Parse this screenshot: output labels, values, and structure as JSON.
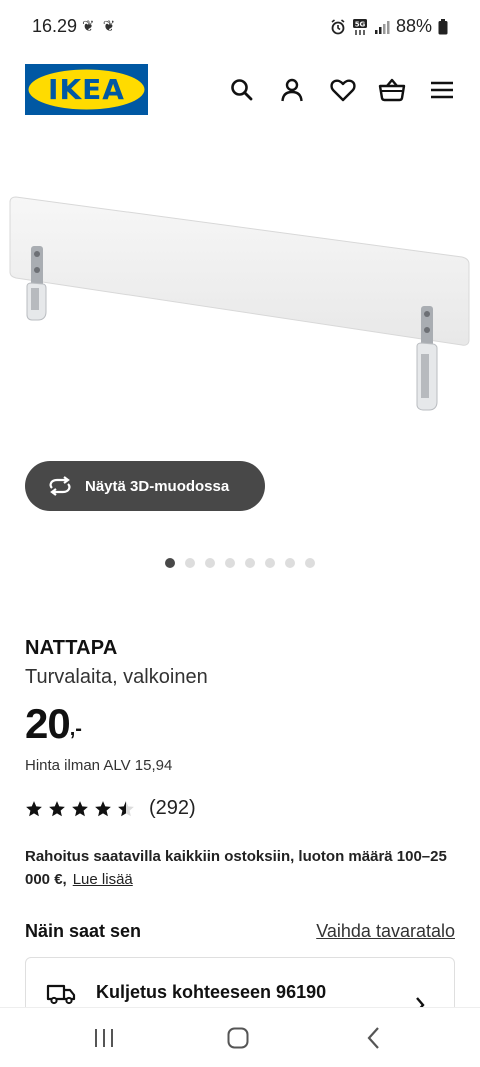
{
  "status_bar": {
    "time": "16.29",
    "notification_icons": "❦ ❦",
    "battery_text": "88%"
  },
  "header": {
    "logo_text": "IKEA",
    "icons": [
      "search-icon",
      "profile-icon",
      "heart-icon",
      "basket-icon",
      "menu-icon"
    ]
  },
  "gallery": {
    "view_3d_label": "Näytä 3D-muodossa",
    "dot_count": 8,
    "active_dot": 0
  },
  "product": {
    "name": "NATTAPA",
    "description": "Turvalaita, valkoinen",
    "price": "20",
    "price_suffix": ",-",
    "price_ex_vat": "Hinta ilman ALV 15,94",
    "rating_value": 4.5,
    "rating_count": "(292)"
  },
  "financing": {
    "text": "Rahoitus saatavilla kaikkiin ostoksiin, luoton määrä 100–25 000 €,",
    "link": "Lue lisää"
  },
  "delivery": {
    "section_title": "Näin saat sen",
    "change_store_link": "Vaihda tavaratalo",
    "option_label": "Kuljetus kohteeseen 96190"
  },
  "colors": {
    "brand_blue": "#0058a3",
    "brand_yellow": "#ffdb00",
    "button_dark": "#484848"
  }
}
